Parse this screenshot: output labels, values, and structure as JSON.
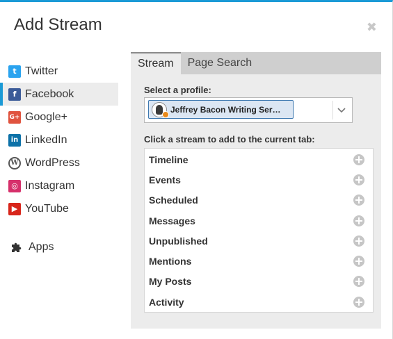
{
  "dialog": {
    "title": "Add Stream",
    "close_symbol": "✖"
  },
  "sidebar": {
    "items": [
      {
        "label": "Twitter",
        "icon": "twitter-icon",
        "glyph": "t",
        "active": false
      },
      {
        "label": "Facebook",
        "icon": "facebook-icon",
        "glyph": "f",
        "active": true
      },
      {
        "label": "Google+",
        "icon": "google-plus-icon",
        "glyph": "G+",
        "active": false
      },
      {
        "label": "LinkedIn",
        "icon": "linkedin-icon",
        "glyph": "in",
        "active": false
      },
      {
        "label": "WordPress",
        "icon": "wordpress-icon",
        "glyph": "W",
        "active": false
      },
      {
        "label": "Instagram",
        "icon": "instagram-icon",
        "glyph": "◎",
        "active": false
      },
      {
        "label": "YouTube",
        "icon": "youtube-icon",
        "glyph": "▶",
        "active": false
      }
    ],
    "apps_label": "Apps"
  },
  "panel": {
    "tabs": [
      {
        "label": "Stream",
        "active": true
      },
      {
        "label": "Page Search",
        "active": false
      }
    ],
    "profile_label": "Select a profile:",
    "selected_profile": "Jeffrey Bacon Writing Ser…",
    "streams_label": "Click a stream to add to the current tab:",
    "streams": [
      "Timeline",
      "Events",
      "Scheduled",
      "Messages",
      "Unpublished",
      "Mentions",
      "My Posts",
      "Activity"
    ]
  },
  "colors": {
    "accent": "#1b9ad6",
    "twitter": "#2aa3ef",
    "facebook": "#3b5b98",
    "google_plus": "#e0533f",
    "linkedin": "#0c71a8",
    "instagram": "#d6306b",
    "youtube": "#d8261b"
  }
}
